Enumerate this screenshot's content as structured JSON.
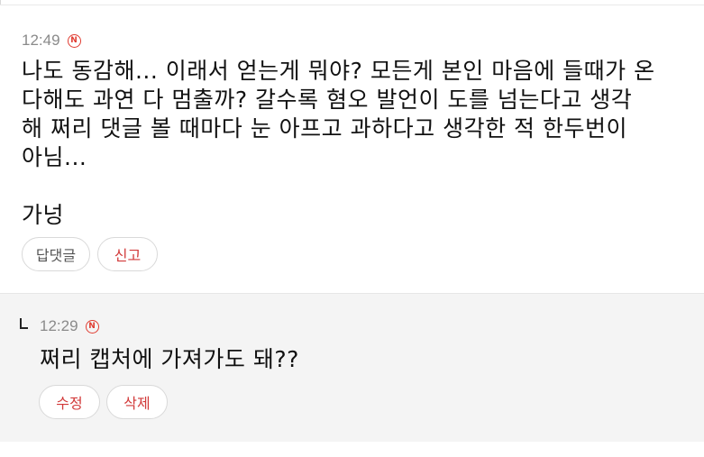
{
  "comment": {
    "time": "12:49",
    "badge": "N",
    "text": "나도 동감해... 이래서 얻는게 뭐야? 모든게 본인 마음에 들때가 온\n다해도 과연 다 멈출까? 갈수록 혐오 발언이 도를 넘는다고 생각\n해 쩌리 댓글 볼 때마다 눈 아프고 과하다고 생각한 적 한두번이\n아님...\n\n가넝",
    "reply_button": "답댓글",
    "report_button": "신고"
  },
  "reply": {
    "time": "12:29",
    "badge": "N",
    "text": "쩌리 캡처에 가져가도 돼??",
    "edit_button": "수정",
    "delete_button": "삭제"
  },
  "colors": {
    "accent_red": "#d23a3a",
    "badge_red": "#e03c31",
    "reply_bg": "#f4f4f4"
  }
}
